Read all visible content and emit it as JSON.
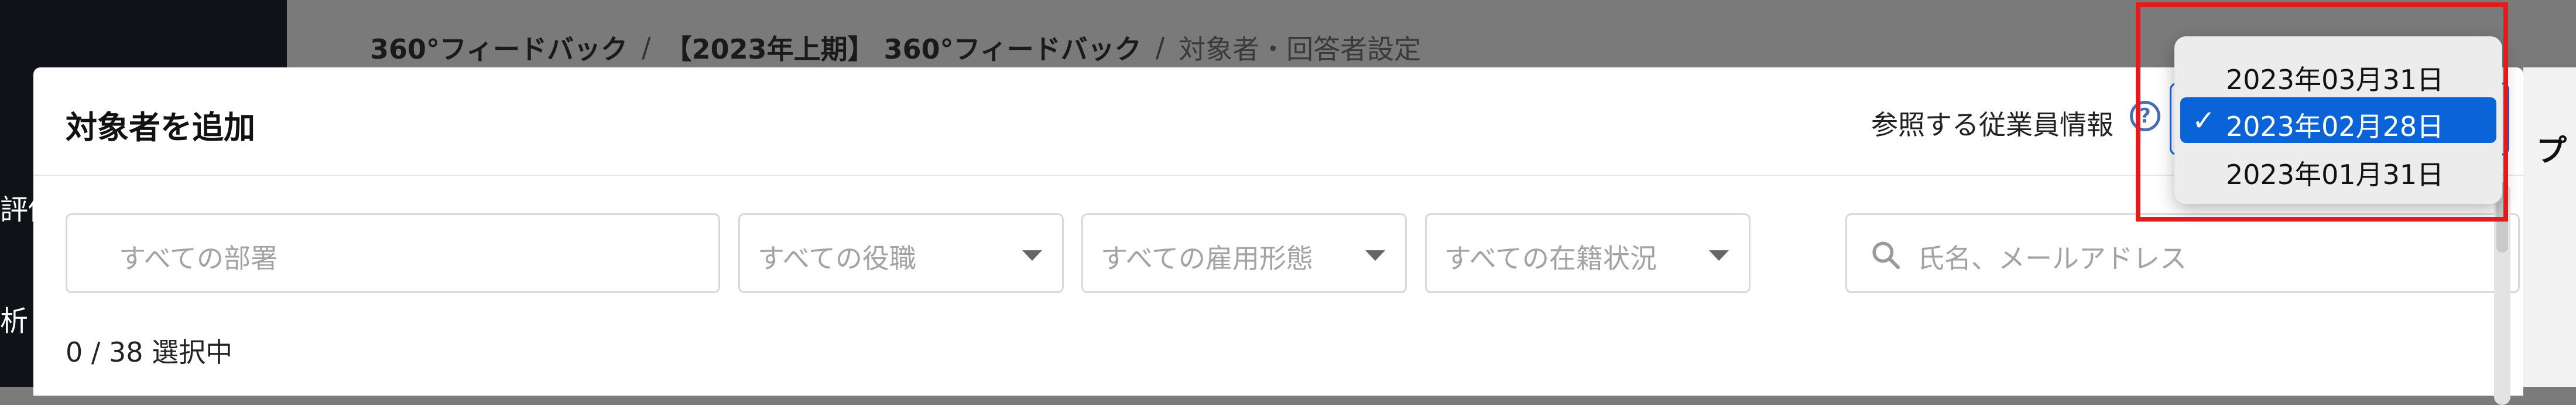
{
  "breadcrumb": {
    "item1": "360°フィードバック",
    "sep1": "/",
    "item2": "【2023年上期】 360°フィードバック",
    "sep2": "/",
    "current": "対象者・回答者設定"
  },
  "sidebar_fragments": {
    "frag1": "評価",
    "frag2": "析"
  },
  "right_fragment": "プ",
  "modal": {
    "title": "対象者を追加",
    "reference_label": "参照する従業員情報",
    "help_icon": "question-circle-icon"
  },
  "filters": {
    "department_placeholder": "すべての部署",
    "role_placeholder": "すべての役職",
    "employment_placeholder": "すべての雇用形態",
    "status_placeholder": "すべての在籍状況",
    "search_placeholder": "氏名、メールアドレス"
  },
  "selection_count": "0 / 38 選択中",
  "date_dropdown": {
    "options": [
      "2023年03月31日",
      "2023年02月28日",
      "2023年01月31日"
    ],
    "selected": "2023年02月28日",
    "check_mark": "✓"
  },
  "colors": {
    "accent": "#0a64d8",
    "highlight": "#e21b1b",
    "help": "#4a6fb0"
  }
}
